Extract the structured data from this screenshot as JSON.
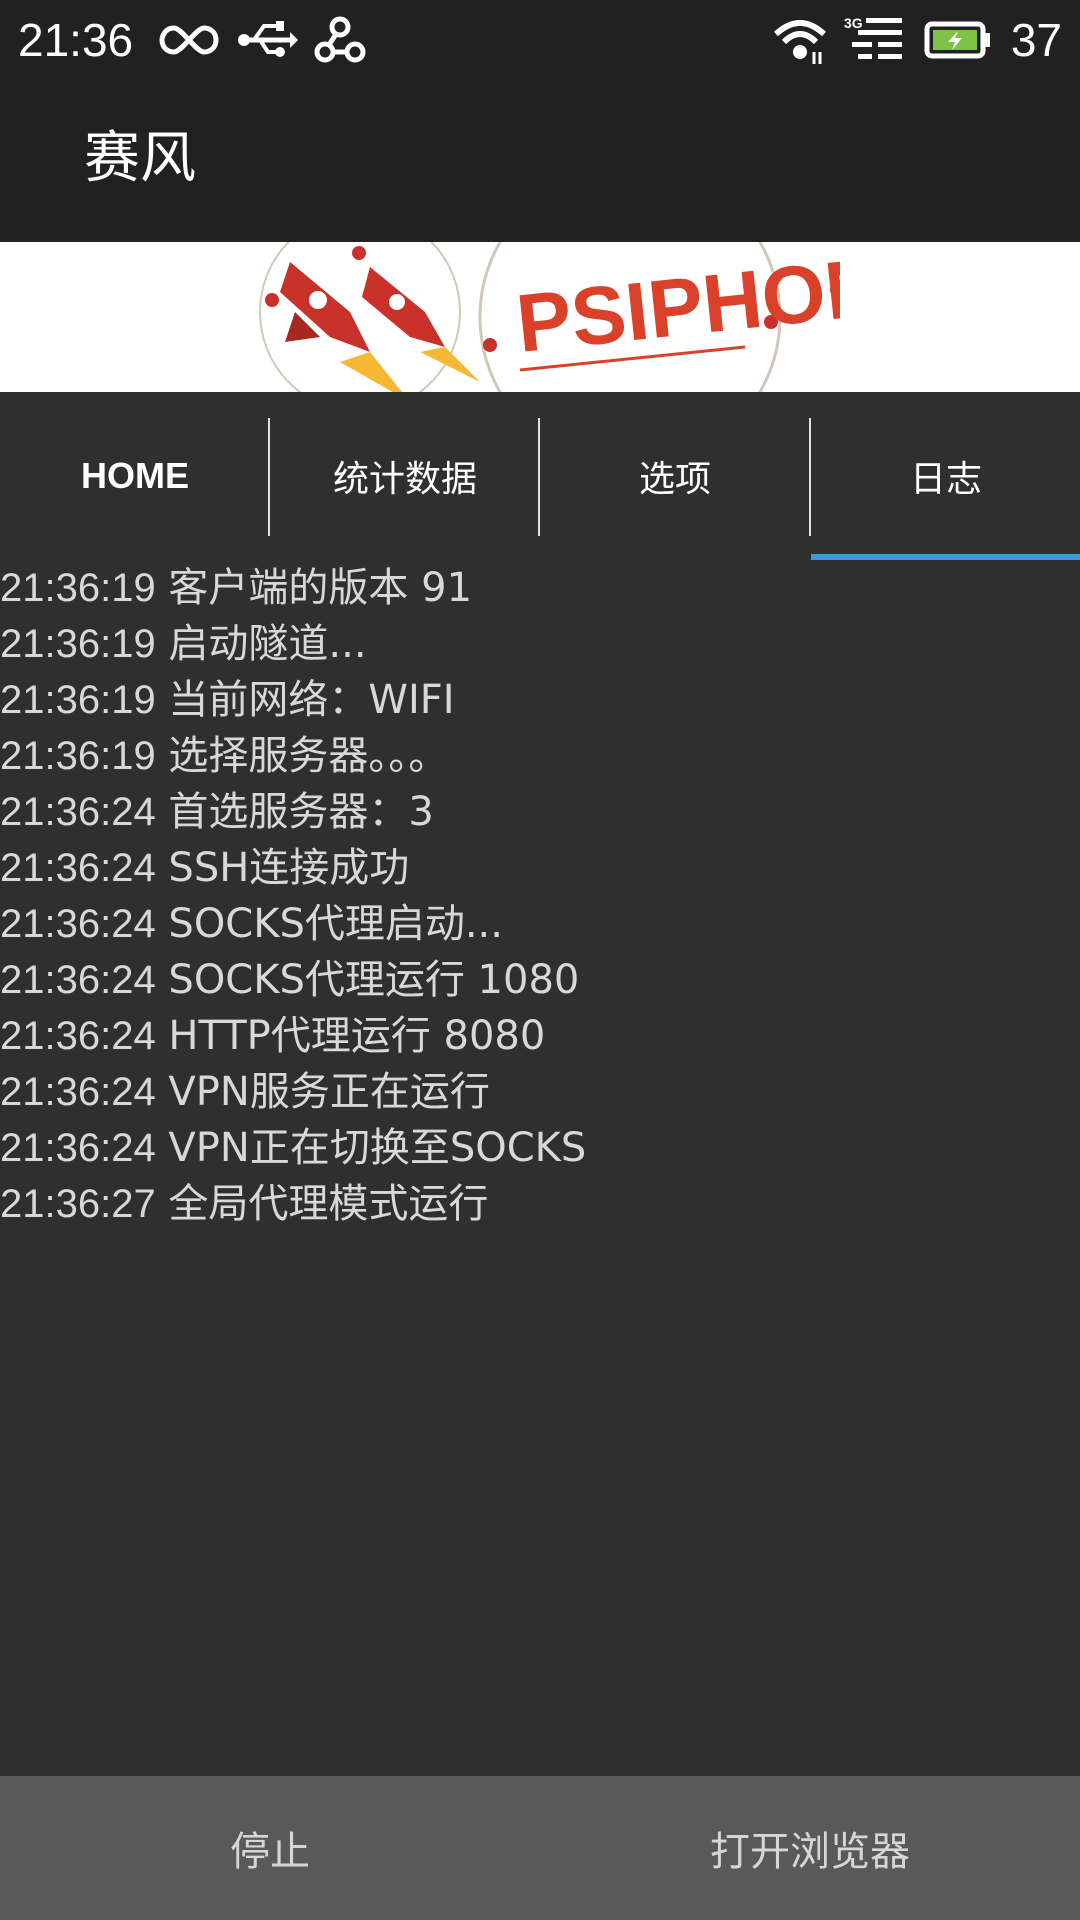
{
  "status_bar": {
    "time": "21:36",
    "battery_level": "37",
    "icons": [
      "infinity-icon",
      "usb-icon",
      "link-icon",
      "wifi-icon",
      "3g-signal-icon",
      "battery-charging-icon"
    ]
  },
  "app": {
    "title": "赛风"
  },
  "banner": {
    "text": "PSIPHON"
  },
  "tabs": [
    {
      "label": "HOME"
    },
    {
      "label": "统计数据"
    },
    {
      "label": "选项"
    },
    {
      "label": "日志",
      "selected": true
    }
  ],
  "log": [
    {
      "time": "21:36:19",
      "message": "客户端的版本 91"
    },
    {
      "time": "21:36:19",
      "message": "启动隧道..."
    },
    {
      "time": "21:36:19",
      "message": "当前网络：WIFI"
    },
    {
      "time": "21:36:19",
      "message": "选择服务器。。。"
    },
    {
      "time": "21:36:24",
      "message": "首选服务器：3"
    },
    {
      "time": "21:36:24",
      "message": "SSH连接成功"
    },
    {
      "time": "21:36:24",
      "message": "SOCKS代理启动..."
    },
    {
      "time": "21:36:24",
      "message": "SOCKS代理运行 1080"
    },
    {
      "time": "21:36:24",
      "message": "HTTP代理运行 8080"
    },
    {
      "time": "21:36:24",
      "message": "VPN服务正在运行"
    },
    {
      "time": "21:36:24",
      "message": "VPN正在切换至SOCKS"
    },
    {
      "time": "21:36:27",
      "message": "全局代理模式运行"
    }
  ],
  "bottom_bar": {
    "stop_label": "停止",
    "open_browser_label": "打开浏览器"
  },
  "colors": {
    "accent": "#3a9bd9",
    "background": "#2f2f2f",
    "toolbar": "#212121",
    "bottom_bar": "#595959",
    "brand_red": "#d9412b"
  }
}
